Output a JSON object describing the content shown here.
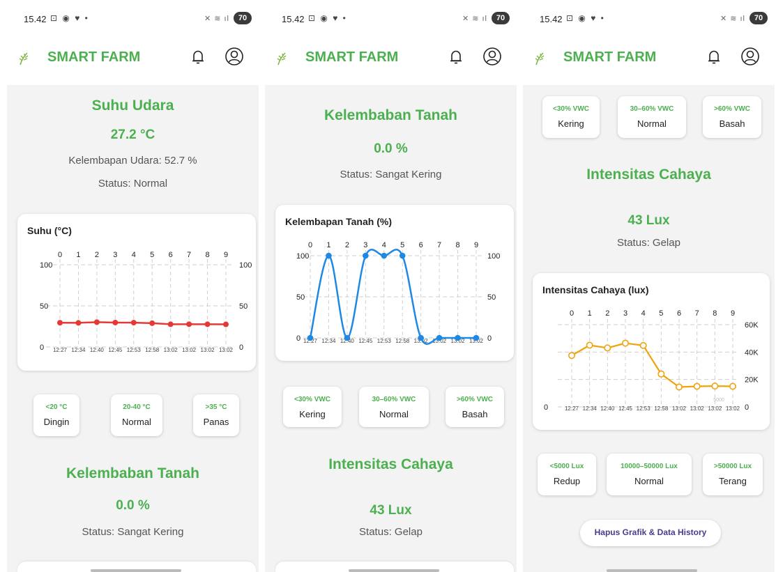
{
  "status_bar": {
    "time": "15.42",
    "battery": "70"
  },
  "app": {
    "title": "SMART FARM"
  },
  "colors": {
    "brand": "#4caf50",
    "temp_line": "#e53935",
    "soil_line": "#1e88e5",
    "light_line": "#f0a30a"
  },
  "icons": [
    "leaf-icon",
    "bell-icon",
    "user-icon"
  ],
  "screen1": {
    "suhu_title": "Suhu Udara",
    "suhu_value": "27.2 °C",
    "kelembapan_udara": "Kelembapan Udara: 52.7 %",
    "suhu_status": "Status: Normal",
    "chart_title": "Suhu (°C)",
    "chips": [
      {
        "range": "<20 °C",
        "label": "Dingin"
      },
      {
        "range": "20-40 °C",
        "label": "Normal"
      },
      {
        "range": ">35 °C",
        "label": "Panas"
      }
    ],
    "tanah_title": "Kelembaban Tanah",
    "tanah_value": "0.0 %",
    "tanah_status": "Status: Sangat Kering"
  },
  "screen2": {
    "tanah_title": "Kelembaban Tanah",
    "tanah_value": "0.0 %",
    "tanah_status": "Status: Sangat Kering",
    "chart_title": "Kelembapan Tanah (%)",
    "chips": [
      {
        "range": "<30% VWC",
        "label": "Kering"
      },
      {
        "range": "30–60% VWC",
        "label": "Normal"
      },
      {
        "range": ">60% VWC",
        "label": "Basah"
      }
    ],
    "cahaya_title": "Intensitas Cahaya",
    "cahaya_value": "43 Lux",
    "cahaya_status": "Status: Gelap"
  },
  "screen3": {
    "chips_top": [
      {
        "range": "<30% VWC",
        "label": "Kering"
      },
      {
        "range": "30–60% VWC",
        "label": "Normal"
      },
      {
        "range": ">60% VWC",
        "label": "Basah"
      }
    ],
    "cahaya_title": "Intensitas Cahaya",
    "cahaya_value": "43 Lux",
    "cahaya_status": "Status: Gelap",
    "chart_title": "Intensitas Cahaya (lux)",
    "chips_bottom": [
      {
        "range": "<5000 Lux",
        "label": "Redup"
      },
      {
        "range": "10000–50000 Lux",
        "label": "Normal"
      },
      {
        "range": ">50000 Lux",
        "label": "Terang"
      }
    ],
    "hapus_button": "Hapus Grafik & Data History"
  },
  "chart_data": [
    {
      "type": "line",
      "title": "Suhu (°C)",
      "x_top": [
        "0",
        "1",
        "2",
        "3",
        "4",
        "5",
        "6",
        "7",
        "8",
        "9"
      ],
      "x_bottom": [
        "12:27",
        "12:34",
        "12:40",
        "12:45",
        "12:53",
        "12:58",
        "13:02",
        "13:02",
        "13:02",
        "13:02"
      ],
      "y_left_ticks": [
        "100",
        "50",
        "0"
      ],
      "y_right_ticks": [
        "100",
        "50",
        "0"
      ],
      "ylim": [
        0,
        100
      ],
      "series": [
        {
          "values": [
            29.5,
            29.3,
            30.2,
            29.7,
            29.6,
            28.9,
            27.6,
            27.7,
            27.6,
            27.5
          ]
        }
      ],
      "grid": true
    },
    {
      "type": "line",
      "title": "Kelembapan Tanah (%)",
      "x_top": [
        "0",
        "1",
        "2",
        "3",
        "4",
        "5",
        "6",
        "7",
        "8",
        "9"
      ],
      "x_bottom": [
        "12:27",
        "12:34",
        "12:40",
        "12:45",
        "12:53",
        "12:58",
        "13:02",
        "13:02",
        "13:02",
        "13:02"
      ],
      "y_left_ticks": [
        "100",
        "50",
        "0"
      ],
      "y_right_ticks": [
        "100",
        "50",
        "0"
      ],
      "ylim": [
        0,
        100
      ],
      "series": [
        {
          "values": [
            0,
            100,
            0,
            100,
            100,
            100,
            0,
            0,
            0,
            0
          ]
        }
      ],
      "grid": true
    },
    {
      "type": "line",
      "title": "Intensitas Cahaya (lux)",
      "x_top": [
        "0",
        "1",
        "2",
        "3",
        "4",
        "5",
        "6",
        "7",
        "8",
        "9"
      ],
      "x_bottom": [
        "12:27",
        "12:34",
        "12:40",
        "12:45",
        "12:53",
        "12:58",
        "13:02",
        "13:02",
        "13:02",
        "13:02"
      ],
      "y_right_ticks": [
        "60K",
        "40K",
        "20K",
        "0"
      ],
      "y_left_ticks": [
        "0"
      ],
      "ylim": [
        0,
        60000
      ],
      "series": [
        {
          "values": [
            37500,
            45000,
            43000,
            46500,
            44800,
            24000,
            14500,
            15000,
            15200,
            15000
          ]
        }
      ],
      "annotation": "5000",
      "grid": true
    }
  ]
}
